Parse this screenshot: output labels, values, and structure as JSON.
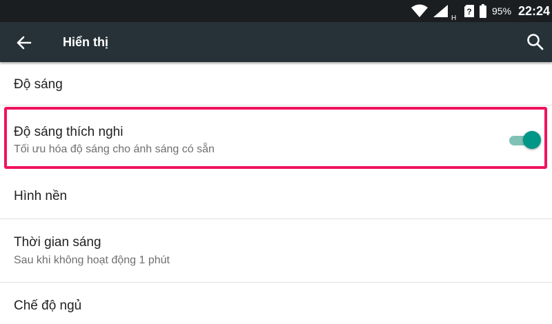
{
  "status_bar": {
    "icons": [
      "wifi-icon",
      "signal-icon",
      "sim-unknown-icon",
      "battery-icon"
    ],
    "network_type": "H",
    "battery_percent": "95%",
    "time": "22:24"
  },
  "app_bar": {
    "back_icon": "arrow-back-icon",
    "title": "Hiển thị",
    "search_icon": "search-icon"
  },
  "settings": {
    "brightness": {
      "title": "Độ sáng"
    },
    "adaptive_brightness": {
      "title": "Độ sáng thích nghi",
      "summary": "Tối ưu hóa độ sáng cho ánh sáng có sẵn",
      "enabled": true
    },
    "wallpaper": {
      "title": "Hình nền"
    },
    "screen_timeout": {
      "title": "Thời gian sáng",
      "summary": "Sau khi không hoạt động 1 phút"
    },
    "sleep_mode": {
      "title": "Chế độ ngủ"
    }
  },
  "colors": {
    "status_bar_bg": "#1b1e21",
    "app_bar_bg": "#263238",
    "highlight_border": "#f0135d",
    "switch_accent": "#009688"
  }
}
